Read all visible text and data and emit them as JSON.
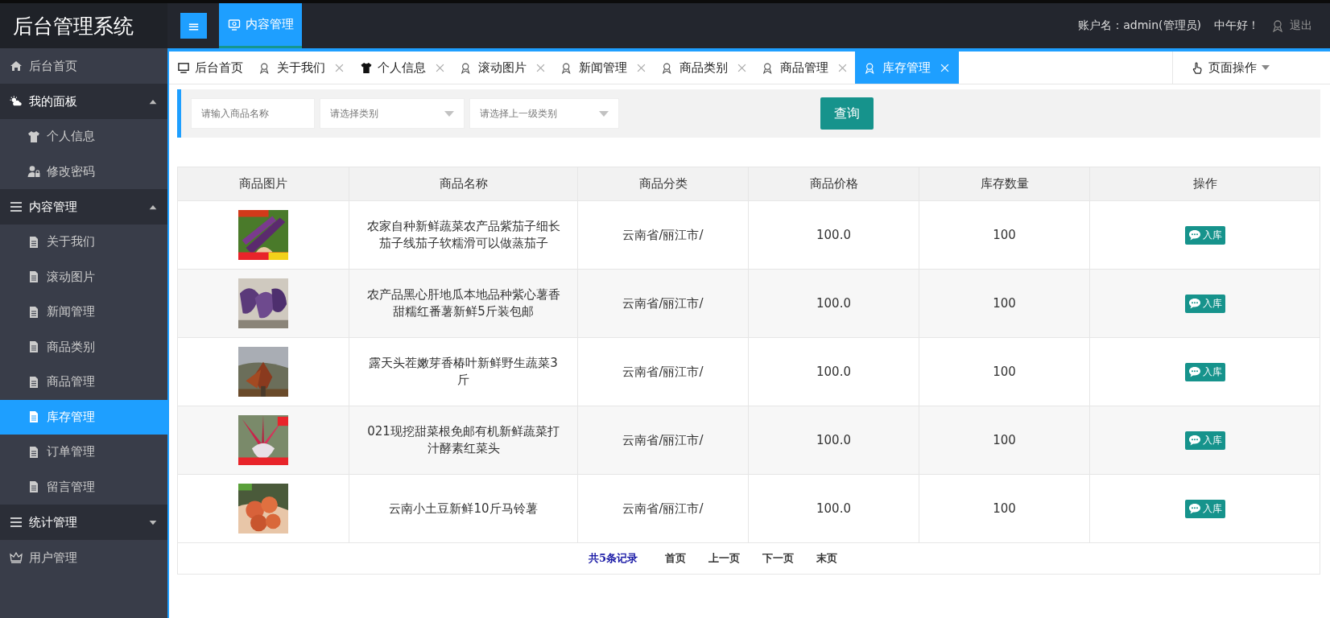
{
  "header": {
    "logo": "后台管理系统",
    "menu_toggle": "≡",
    "module_tab": {
      "label": "内容管理",
      "selected": true
    },
    "account": "账户名：admin(管理员)",
    "greeting": "中午好！",
    "logout": "退出"
  },
  "sidebar": {
    "items": [
      {
        "label": "后台首页",
        "kind": "link",
        "selected": false
      },
      {
        "label": "我的面板",
        "kind": "group",
        "expanded": true,
        "children": [
          {
            "label": "个人信息",
            "selected": false
          },
          {
            "label": "修改密码",
            "selected": false
          }
        ]
      },
      {
        "label": "内容管理",
        "kind": "group",
        "expanded": true,
        "children": [
          {
            "label": "关于我们",
            "selected": false
          },
          {
            "label": "滚动图片",
            "selected": false
          },
          {
            "label": "新闻管理",
            "selected": false
          },
          {
            "label": "商品类别",
            "selected": false
          },
          {
            "label": "商品管理",
            "selected": false
          },
          {
            "label": "库存管理",
            "selected": true
          },
          {
            "label": "订单管理",
            "selected": false
          },
          {
            "label": "留言管理",
            "selected": false
          }
        ]
      },
      {
        "label": "统计管理",
        "kind": "group",
        "expanded": false
      },
      {
        "label": "用户管理",
        "kind": "link",
        "selected": false
      }
    ]
  },
  "tabs": [
    {
      "label": "后台首页",
      "kind": "monitor",
      "closable": false,
      "selected": false
    },
    {
      "label": "关于我们",
      "kind": "badge",
      "closable": true,
      "selected": false
    },
    {
      "label": "个人信息",
      "kind": "shirt",
      "closable": true,
      "selected": false
    },
    {
      "label": "滚动图片",
      "kind": "badge",
      "closable": true,
      "selected": false
    },
    {
      "label": "新闻管理",
      "kind": "badge",
      "closable": true,
      "selected": false
    },
    {
      "label": "商品类别",
      "kind": "badge",
      "closable": true,
      "selected": false
    },
    {
      "label": "商品管理",
      "kind": "badge",
      "closable": true,
      "selected": false
    },
    {
      "label": "库存管理",
      "kind": "badge",
      "closable": true,
      "selected": true
    }
  ],
  "page_actions": "页面操作",
  "search": {
    "name_placeholder": "请输入商品名称",
    "category_placeholder": "请选择类别",
    "parent_category_placeholder": "请选择上一级类别",
    "button": "查询"
  },
  "table": {
    "columns": [
      "商品图片",
      "商品名称",
      "商品分类",
      "商品价格",
      "库存数量",
      "操作"
    ],
    "rows": [
      {
        "name": "农家自种新鲜蔬菜农产品紫茄子细长茄子线茄子软糯滑可以做蒸茄子",
        "category": "云南省/丽江市/",
        "price": "100.0",
        "stock": "100",
        "action": "入库"
      },
      {
        "name": "农产品黑心肝地瓜本地品种紫心薯香甜糯红番薯新鲜5斤装包邮",
        "category": "云南省/丽江市/",
        "price": "100.0",
        "stock": "100",
        "action": "入库"
      },
      {
        "name": "露天头茬嫩芽香椿叶新鲜野生蔬菜3斤",
        "category": "云南省/丽江市/",
        "price": "100.0",
        "stock": "100",
        "action": "入库"
      },
      {
        "name": "021现挖甜菜根免邮有机新鲜蔬菜打汁酵素红菜头",
        "category": "云南省/丽江市/",
        "price": "100.0",
        "stock": "100",
        "action": "入库"
      },
      {
        "name": "云南小土豆新鲜10斤马铃薯",
        "category": "云南省/丽江市/",
        "price": "100.0",
        "stock": "100",
        "action": "入库"
      }
    ]
  },
  "pager": {
    "total": "共5条记录",
    "links": [
      "首页",
      "上一页",
      "下一页",
      "末页"
    ]
  }
}
